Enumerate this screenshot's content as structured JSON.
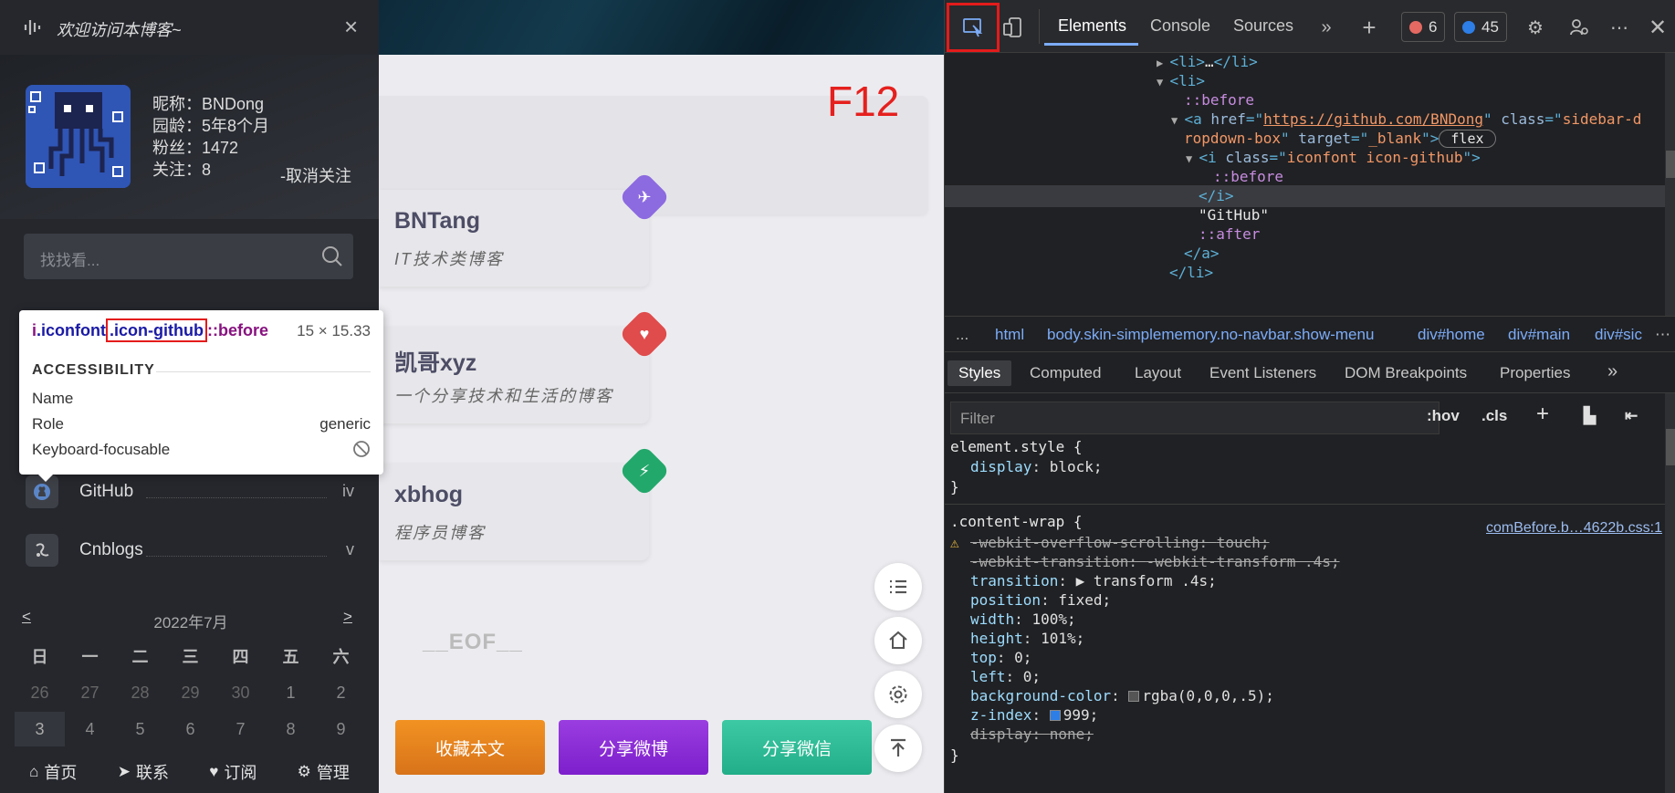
{
  "sidebar": {
    "welcome": "欢迎访问本博客~",
    "close": "×",
    "profile": {
      "nickname": "昵称：BNDong",
      "age": "园龄：5年8个月",
      "fans": "粉丝：1472",
      "follow": "关注：8",
      "unfollow": "-取消关注"
    },
    "search_placeholder": "找找看...",
    "menu": [
      {
        "icon": "github-icon",
        "label": "GitHub",
        "tail": "iv"
      },
      {
        "icon": "cnblogs-icon",
        "label": "Cnblogs",
        "tail": "v"
      }
    ],
    "calendar": {
      "title": "2022年7月",
      "prev": "<",
      "next": ">",
      "weekdays": [
        "日",
        "一",
        "二",
        "三",
        "四",
        "五",
        "六"
      ],
      "rows": [
        [
          "26",
          "27",
          "28",
          "29",
          "30",
          "1",
          "2"
        ],
        [
          "3",
          "4",
          "5",
          "6",
          "7",
          "8",
          "9"
        ]
      ]
    },
    "bottom": [
      {
        "icon": "home-icon",
        "label": "首页"
      },
      {
        "icon": "paper-plane-icon",
        "label": "联系"
      },
      {
        "icon": "heart-icon",
        "label": "订阅"
      },
      {
        "icon": "gear-icon",
        "label": "管理"
      }
    ]
  },
  "tooltip": {
    "tag": "i",
    "class_a": ".iconfont",
    "class_b": ".icon-github",
    "pseudo": "::before",
    "size": "15 × 15.33",
    "accessibility": "ACCESSIBILITY",
    "rows": [
      {
        "k": "Name",
        "v": ""
      },
      {
        "k": "Role",
        "v": "generic"
      },
      {
        "k": "Keyboard-focusable",
        "v": ""
      }
    ]
  },
  "blog": {
    "f12": "F12",
    "friends": [
      {
        "name": "BNTang",
        "desc": "IT技术类博客",
        "badge_color": "#8c6ae0",
        "badge_icon": "✈"
      },
      {
        "name": "凯哥xyz",
        "desc": "一个分享技术和生活的博客",
        "badge_color": "#e04b4b",
        "badge_icon": "♥"
      },
      {
        "name": "xbhog",
        "desc": "程序员博客",
        "badge_color": "#23a86b",
        "badge_icon": "⚡"
      }
    ],
    "eof": "__EOF__",
    "share": [
      {
        "label": "收藏本文",
        "color": "#e58a1f"
      },
      {
        "label": "分享微博",
        "color": "#8c2bd6"
      },
      {
        "label": "分享微信",
        "color": "#2fbf9a"
      }
    ]
  },
  "devtools": {
    "tabs": [
      "Elements",
      "Console",
      "Sources"
    ],
    "errors": "6",
    "messages": "45",
    "dom": [
      {
        "indent": 0,
        "arrow": "▶",
        "parts": [
          [
            "tag",
            "<li>"
          ],
          [
            "str",
            "…"
          ],
          [
            "tag",
            "</li>"
          ]
        ]
      },
      {
        "indent": 0,
        "arrow": "▼",
        "parts": [
          [
            "tag",
            "<li>"
          ]
        ]
      },
      {
        "indent": 1,
        "arrow": "",
        "parts": [
          [
            "pse",
            "::before"
          ]
        ]
      },
      {
        "indent": 1,
        "arrow": "▼",
        "parts": [
          [
            "tag",
            "<a "
          ],
          [
            "attr",
            "href"
          ],
          [
            "tag",
            "=\""
          ],
          [
            "val",
            "https://github.com/BNDong"
          ],
          [
            "tag",
            "\" "
          ],
          [
            "attr",
            "class"
          ],
          [
            "tag",
            "=\""
          ],
          [
            "val",
            "sidebar-d"
          ]
        ]
      },
      {
        "indent": 1,
        "arrow": "",
        "parts": [
          [
            "val",
            "ropdown-box"
          ],
          [
            "tag",
            "\" "
          ],
          [
            "attr",
            "target"
          ],
          [
            "tag",
            "=\""
          ],
          [
            "val",
            "_blank"
          ],
          [
            "tag",
            "\">"
          ],
          [
            "str",
            " flex "
          ]
        ]
      },
      {
        "indent": 2,
        "arrow": "▼",
        "parts": [
          [
            "tag",
            "<i "
          ],
          [
            "attr",
            "class"
          ],
          [
            "tag",
            "=\""
          ],
          [
            "val",
            "iconfont icon-github"
          ],
          [
            "tag",
            "\">"
          ]
        ]
      },
      {
        "indent": 3,
        "arrow": "",
        "parts": [
          [
            "pse",
            "::before"
          ]
        ]
      },
      {
        "indent": 2,
        "arrow": "",
        "parts": [
          [
            "tag",
            "</i>"
          ]
        ]
      },
      {
        "indent": 2,
        "arrow": "",
        "parts": [
          [
            "str",
            "\"GitHub\""
          ]
        ]
      },
      {
        "indent": 2,
        "arrow": "",
        "parts": [
          [
            "pse",
            "::after"
          ]
        ]
      },
      {
        "indent": 1,
        "arrow": "",
        "parts": [
          [
            "tag",
            "</a>"
          ]
        ]
      },
      {
        "indent": 0,
        "arrow": "",
        "parts": [
          [
            "tag",
            "</li>"
          ]
        ]
      }
    ],
    "breadcrumbs": [
      "...",
      "html",
      "body.skin-simplememory.no-navbar.show-menu",
      "div#home",
      "div#main",
      "div#sic"
    ],
    "style_tabs": [
      "Styles",
      "Computed",
      "Layout",
      "Event Listeners",
      "DOM Breakpoints",
      "Properties"
    ],
    "filter_placeholder": "Filter",
    "hov": ":hov",
    "cls": ".cls",
    "element_style": {
      "selector": "element.style {",
      "decls": [
        [
          "display",
          "block;"
        ]
      ]
    },
    "content_wrap": {
      "selector": ".content-wrap {",
      "source": "comBefore.b…4622b.css:1",
      "decls": [
        {
          "p": "-webkit-overflow-scrolling",
          "v": "touch;",
          "strike": true,
          "warn": true
        },
        {
          "p": "-webkit-transition",
          "v": "-webkit-transform .4s;",
          "strike": true
        },
        {
          "p": "transition",
          "v": "▶ transform .4s;"
        },
        {
          "p": "position",
          "v": "fixed;"
        },
        {
          "p": "width",
          "v": "100%;"
        },
        {
          "p": "height",
          "v": "101%;"
        },
        {
          "p": "top",
          "v": "0;"
        },
        {
          "p": "left",
          "v": "0;"
        },
        {
          "p": "background-color",
          "v": "rgba(0,0,0,.5);",
          "swatch": "#555"
        },
        {
          "p": "z-index",
          "v": "999;",
          "swatch": "#2d7ee6"
        },
        {
          "p": "display",
          "v": "none;",
          "strike": true
        }
      ],
      "close": "}"
    }
  }
}
